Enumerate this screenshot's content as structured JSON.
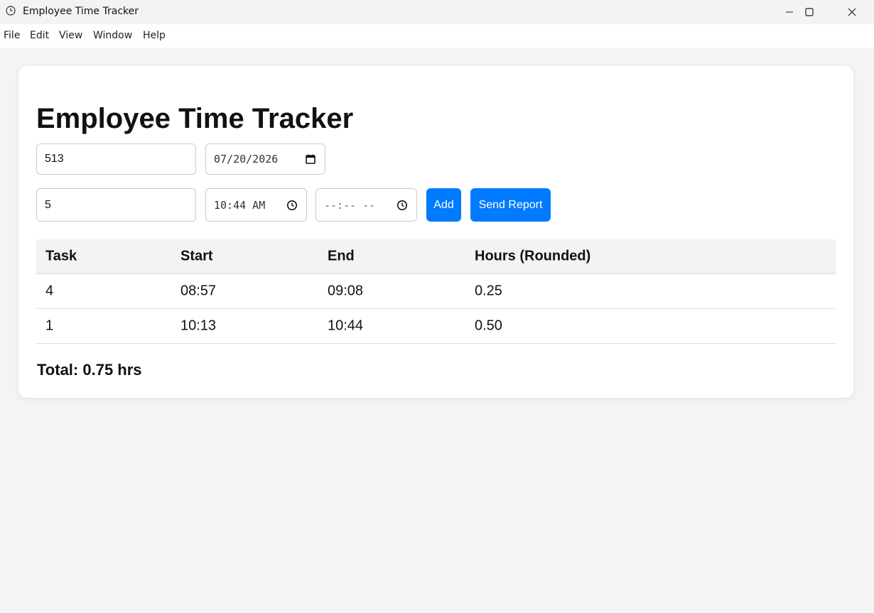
{
  "window": {
    "title": "Employee Time Tracker",
    "icon": "clock-icon",
    "controls": [
      "minimize-icon",
      "maximize-icon",
      "close-icon"
    ]
  },
  "menu": {
    "items": [
      "File",
      "Edit",
      "View",
      "Window",
      "Help"
    ]
  },
  "main": {
    "heading": "Employee Time Tracker",
    "employee_id_value": "513",
    "date_value": "07/20/2026",
    "task_value": "5",
    "start_time_value": "10:44 AM",
    "end_time_placeholder": "--:-- --",
    "add_label": "Add",
    "send_report_label": "Send Report"
  },
  "table": {
    "columns": [
      "Task",
      "Start",
      "End",
      "Hours (Rounded)"
    ],
    "rows": [
      [
        "4",
        "08:57",
        "09:08",
        "0.25"
      ],
      [
        "1",
        "10:13",
        "10:44",
        "0.50"
      ]
    ]
  },
  "summary": {
    "total": "Total: 0.75 hrs"
  },
  "colors": {
    "accent": "#007bff",
    "background": "#f3f4f6"
  }
}
